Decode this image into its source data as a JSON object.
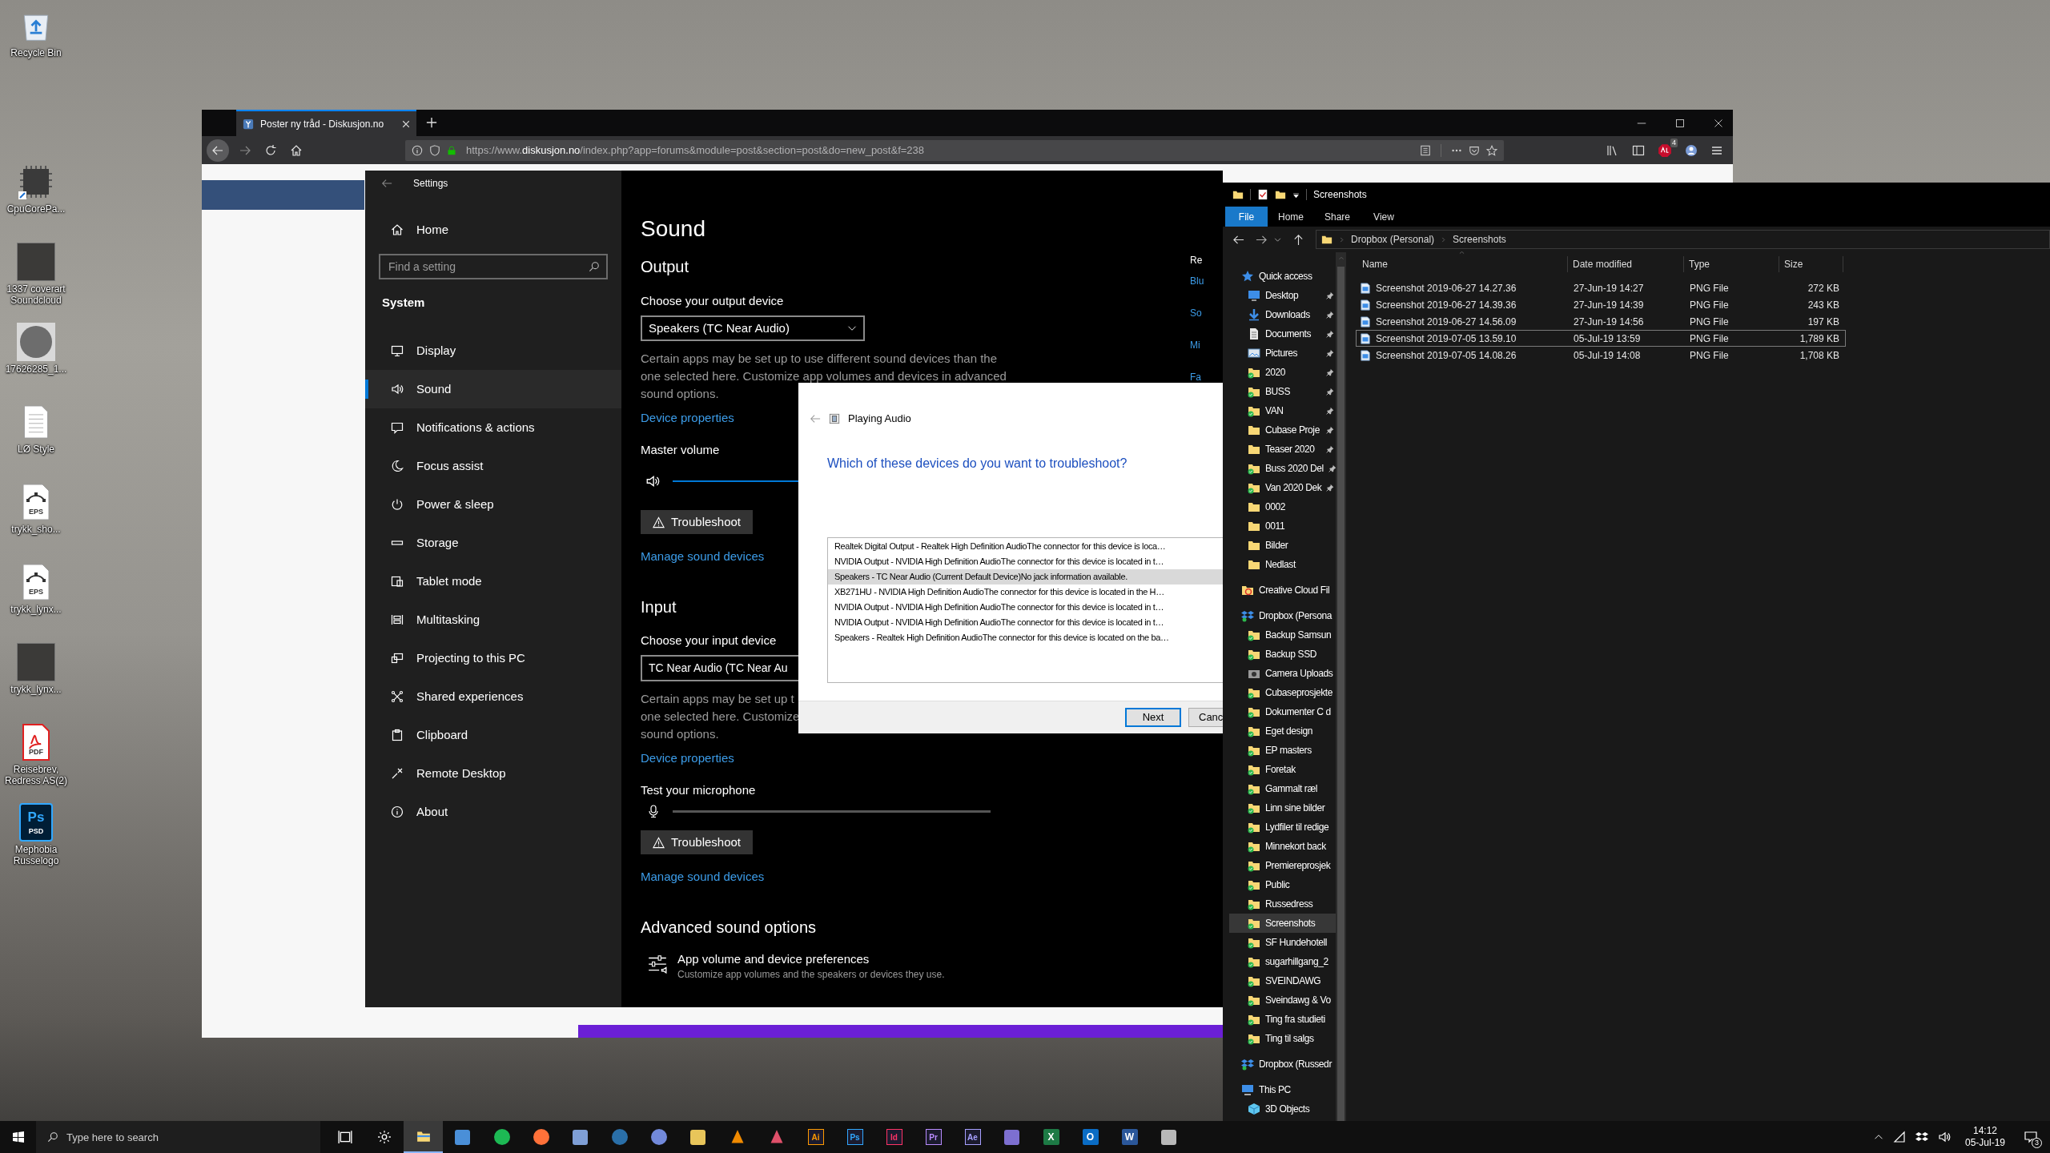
{
  "desktop_icons": [
    {
      "label": "Recycle Bin",
      "kind": "recycle"
    },
    {
      "label": "CpuCorePa...",
      "kind": "chip"
    },
    {
      "label": "1337 coverart Soundcloud",
      "kind": "photo"
    },
    {
      "label": "17626285_1...",
      "kind": "avatar"
    },
    {
      "label": "LØ Style",
      "kind": "document"
    },
    {
      "label": "trykk_sho...",
      "kind": "vector",
      "badge": "EPS"
    },
    {
      "label": "trykk_lynx...",
      "kind": "vector",
      "badge": "EPS"
    },
    {
      "label": "trykk_lynx...",
      "kind": "photo"
    },
    {
      "label": "Reisebrev, Redress AS(2)",
      "kind": "pdf",
      "badge": "PDF"
    },
    {
      "label": "Mephobia Russelogo",
      "kind": "psd",
      "logo": "Ps",
      "badge": "PSD"
    }
  ],
  "browser": {
    "tab_title": "Poster ny tråd - Diskusjon.no",
    "url": {
      "scheme": "https://www.",
      "domain": "diskusjon.no",
      "path": "/index.php?app=forums&module=post&section=post&do=new_post&f=238"
    },
    "extension_badge": "4"
  },
  "settings": {
    "title": "Settings",
    "home": "Home",
    "search_placeholder": "Find a setting",
    "section": "System",
    "nav": [
      {
        "label": "Display",
        "selected": false
      },
      {
        "label": "Sound",
        "selected": true
      },
      {
        "label": "Notifications & actions",
        "selected": false
      },
      {
        "label": "Focus assist",
        "selected": false
      },
      {
        "label": "Power & sleep",
        "selected": false
      },
      {
        "label": "Storage",
        "selected": false
      },
      {
        "label": "Tablet mode",
        "selected": false
      },
      {
        "label": "Multitasking",
        "selected": false
      },
      {
        "label": "Projecting to this PC",
        "selected": false
      },
      {
        "label": "Shared experiences",
        "selected": false
      },
      {
        "label": "Clipboard",
        "selected": false
      },
      {
        "label": "Remote Desktop",
        "selected": false
      },
      {
        "label": "About",
        "selected": false
      }
    ],
    "page_title": "Sound",
    "output": {
      "heading": "Output",
      "device_label": "Choose your output device",
      "device": "Speakers (TC Near Audio)",
      "description": [
        "Certain apps may be set up to use different sound devices than the",
        "one selected here. Customize app volumes and devices in advanced",
        "sound options."
      ],
      "properties_link": "Device properties",
      "volume_label": "Master volume",
      "volume": {
        "level": 1
      },
      "troubleshoot": "Troubleshoot",
      "manage_link": "Manage sound devices"
    },
    "input": {
      "heading": "Input",
      "device_label": "Choose your input device",
      "device": "TC Near Audio (TC Near Au",
      "description": [
        "Certain apps may be set up t",
        "one selected here. Customize",
        "sound options."
      ],
      "properties_link": "Device properties",
      "test_label": "Test your microphone",
      "mic": {
        "level": 0
      },
      "troubleshoot": "Troubleshoot",
      "manage_link": "Manage sound devices"
    },
    "advanced": {
      "heading": "Advanced sound options",
      "item_title": "App volume and device preferences",
      "item_subtitle": "Customize app volumes and the speakers or devices they use."
    },
    "related": [
      {
        "text": "Re",
        "kind": "heading"
      },
      {
        "text": "Blu",
        "kind": "link"
      },
      {
        "text": "So",
        "kind": "link"
      },
      {
        "text": "Mi",
        "kind": "link"
      },
      {
        "text": "Fa",
        "kind": "link"
      }
    ]
  },
  "dialog": {
    "title": "Playing Audio",
    "question": "Which of these devices do you want to troubleshoot?",
    "devices": [
      {
        "text": "Realtek Digital Output - Realtek High Definition AudioThe connector for this device is loca…",
        "selected": false
      },
      {
        "text": "NVIDIA Output - NVIDIA High Definition AudioThe connector for this device is located in t…",
        "selected": false
      },
      {
        "text": "Speakers - TC Near Audio (Current Default Device)No jack information available.",
        "selected": true
      },
      {
        "text": "XB271HU - NVIDIA High Definition AudioThe connector for this device is located in the H…",
        "selected": false
      },
      {
        "text": "NVIDIA Output - NVIDIA High Definition AudioThe connector for this device is located in t…",
        "selected": false
      },
      {
        "text": "NVIDIA Output - NVIDIA High Definition AudioThe connector for this device is located in t…",
        "selected": false
      },
      {
        "text": "Speakers - Realtek High Definition AudioThe connector for this device is located on the ba…",
        "selected": false
      }
    ],
    "buttons": [
      {
        "label": "Next",
        "kind": "default"
      },
      {
        "label": "Canc",
        "kind": "normal"
      }
    ]
  },
  "explorer": {
    "title": "Screenshots",
    "ribbon_tabs": [
      {
        "label": "File",
        "selected": true
      },
      {
        "label": "Home",
        "selected": false
      },
      {
        "label": "Share",
        "selected": false
      },
      {
        "label": "View",
        "selected": false
      }
    ],
    "breadcrumb": [
      "Dropbox (Personal)",
      "Screenshots"
    ],
    "tree": [
      {
        "label": "Quick access",
        "kind": "star",
        "selected": false,
        "children": [
          {
            "label": "Desktop",
            "kind": "desktop",
            "selected": false,
            "pinned": true
          },
          {
            "label": "Downloads",
            "kind": "download",
            "selected": false,
            "pinned": true
          },
          {
            "label": "Documents",
            "kind": "documents",
            "selected": false,
            "pinned": true
          },
          {
            "label": "Pictures",
            "kind": "pictures",
            "selected": false,
            "pinned": true
          },
          {
            "label": "2020",
            "kind": "synced",
            "selected": false,
            "pinned": true
          },
          {
            "label": "BUSS",
            "kind": "synced",
            "selected": false,
            "pinned": true
          },
          {
            "label": "VAN",
            "kind": "synced",
            "selected": false,
            "pinned": true
          },
          {
            "label": "Cubase Proje",
            "kind": "folder",
            "selected": false,
            "pinned": true
          },
          {
            "label": "Teaser 2020",
            "kind": "folder",
            "selected": false,
            "pinned": true
          },
          {
            "label": "Buss 2020 Del",
            "kind": "synced",
            "selected": false,
            "pinned": true
          },
          {
            "label": "Van 2020 Dek",
            "kind": "synced",
            "selected": false,
            "pinned": true
          },
          {
            "label": "0002",
            "kind": "folder",
            "selected": false,
            "pinned": false
          },
          {
            "label": "0011",
            "kind": "folder",
            "selected": false,
            "pinned": false
          },
          {
            "label": "Bilder",
            "kind": "folder",
            "selected": false,
            "pinned": false
          },
          {
            "label": "Nedlast",
            "kind": "folder",
            "selected": false,
            "pinned": false
          }
        ]
      },
      {
        "label": "Creative Cloud Fil",
        "kind": "cloud",
        "selected": false
      },
      {
        "label": "Dropbox (Persona",
        "kind": "dropbox",
        "selected": false,
        "children": [
          {
            "label": "Backup Samsun",
            "kind": "synced",
            "selected": false
          },
          {
            "label": "Backup SSD",
            "kind": "synced",
            "selected": false
          },
          {
            "label": "Camera Uploads",
            "kind": "camera",
            "selected": false
          },
          {
            "label": "Cubaseprosjekte",
            "kind": "synced",
            "selected": false
          },
          {
            "label": "Dokumenter C d",
            "kind": "synced",
            "selected": false
          },
          {
            "label": "Eget design",
            "kind": "synced",
            "selected": false
          },
          {
            "label": "EP masters",
            "kind": "synced",
            "selected": false
          },
          {
            "label": "Foretak",
            "kind": "synced",
            "selected": false
          },
          {
            "label": "Gammalt ræl",
            "kind": "synced",
            "selected": false
          },
          {
            "label": "Linn sine bilder",
            "kind": "synced",
            "selected": false
          },
          {
            "label": "Lydfiler til redige",
            "kind": "synced",
            "selected": false
          },
          {
            "label": "Minnekort back",
            "kind": "synced",
            "selected": false
          },
          {
            "label": "Premiereprosjek",
            "kind": "synced",
            "selected": false
          },
          {
            "label": "Public",
            "kind": "synced",
            "selected": false
          },
          {
            "label": "Russedress",
            "kind": "synced",
            "selected": false
          },
          {
            "label": "Screenshots",
            "kind": "synced",
            "selected": true
          },
          {
            "label": "SF Hundehotell",
            "kind": "synced",
            "selected": false
          },
          {
            "label": "sugarhillgang_2",
            "kind": "synced",
            "selected": false
          },
          {
            "label": "SVEINDAWG",
            "kind": "synced",
            "selected": false
          },
          {
            "label": "Sveindawg & Vo",
            "kind": "synced",
            "selected": false
          },
          {
            "label": "Ting fra studieti",
            "kind": "synced",
            "selected": false
          },
          {
            "label": "Ting til salgs",
            "kind": "synced",
            "selected": false
          }
        ]
      },
      {
        "label": "Dropbox (Russedr",
        "kind": "dropbox",
        "selected": false
      },
      {
        "label": "This PC",
        "kind": "pc",
        "selected": false,
        "children": [
          {
            "label": "3D Objects",
            "kind": "cube",
            "selected": false
          }
        ]
      }
    ],
    "columns": [
      "Name",
      "Date modified",
      "Type",
      "Size"
    ],
    "files": [
      {
        "name": "Screenshot 2019-06-27 14.27.36",
        "date": "27-Jun-19 14:27",
        "type": "PNG File",
        "size": "272 KB",
        "selected": false
      },
      {
        "name": "Screenshot 2019-06-27 14.39.36",
        "date": "27-Jun-19 14:39",
        "type": "PNG File",
        "size": "243 KB",
        "selected": false
      },
      {
        "name": "Screenshot 2019-06-27 14.56.09",
        "date": "27-Jun-19 14:56",
        "type": "PNG File",
        "size": "197 KB",
        "selected": false
      },
      {
        "name": "Screenshot 2019-07-05 13.59.10",
        "date": "05-Jul-19 13:59",
        "type": "PNG File",
        "size": "1,789 KB",
        "selected": true
      },
      {
        "name": "Screenshot 2019-07-05 14.08.26",
        "date": "05-Jul-19 14:08",
        "type": "PNG File",
        "size": "1,708 KB",
        "selected": false
      }
    ]
  },
  "taskbar": {
    "search_placeholder": "Type here to search",
    "apps": [
      {
        "kind": "taskview",
        "selected": false
      },
      {
        "kind": "gear",
        "selected": false
      },
      {
        "kind": "folder",
        "selected": true
      },
      {
        "kind": "square",
        "color": "#4a8fd8",
        "selected": false
      },
      {
        "kind": "round",
        "color": "#1db954",
        "selected": false
      },
      {
        "kind": "round",
        "color": "#ff7139",
        "selected": false
      },
      {
        "kind": "square",
        "color": "#7f9fd6",
        "selected": false
      },
      {
        "kind": "round",
        "color": "#2a6fa8",
        "selected": false
      },
      {
        "kind": "round",
        "color": "#7289da",
        "selected": false
      },
      {
        "kind": "square",
        "color": "#e8c55a",
        "selected": false
      },
      {
        "kind": "triangle",
        "color": "#f08a00",
        "selected": false
      },
      {
        "kind": "triangle",
        "color": "#e0506a",
        "selected": false
      },
      {
        "kind": "outline",
        "label": "Ai",
        "color": "#ff9a00",
        "selected": false
      },
      {
        "kind": "outline",
        "label": "Ps",
        "color": "#31a8ff",
        "selected": false
      },
      {
        "kind": "outline",
        "label": "Id",
        "color": "#ff3366",
        "selected": false
      },
      {
        "kind": "outline",
        "label": "Pr",
        "color": "#b98cff",
        "selected": false
      },
      {
        "kind": "outline",
        "label": "Ae",
        "color": "#a7a0ff",
        "selected": false
      },
      {
        "kind": "square",
        "color": "#7d6fd0",
        "selected": false
      },
      {
        "kind": "filled",
        "label": "X",
        "color": "#1d7a45",
        "selected": false
      },
      {
        "kind": "filled",
        "label": "O",
        "color": "#0a6cc4",
        "selected": false
      },
      {
        "kind": "filled",
        "label": "W",
        "color": "#2b579a",
        "selected": false
      },
      {
        "kind": "square",
        "color": "#b8b8b8",
        "selected": false
      }
    ],
    "time": "14:12",
    "date": "05-Jul-19",
    "notification_count": "3"
  }
}
